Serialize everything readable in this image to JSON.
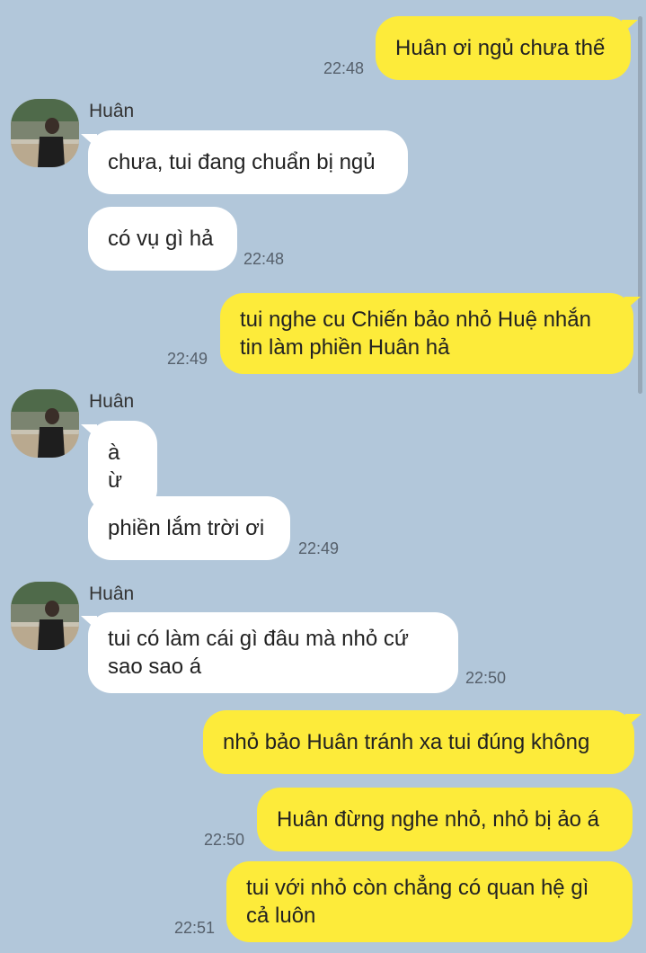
{
  "chat": {
    "contact_name": "Huân",
    "messages": [
      {
        "side": "out",
        "text": "Huân ơi ngủ chưa thế",
        "time": "22:48"
      },
      {
        "side": "in",
        "text": "chưa, tui đang chuẩn bị ngủ",
        "time": ""
      },
      {
        "side": "in",
        "text": "có vụ gì hả",
        "time": "22:48"
      },
      {
        "side": "out",
        "text": "tui nghe cu Chiến bảo nhỏ Huệ nhắn tin làm phiền Huân hả",
        "time": "22:49"
      },
      {
        "side": "in",
        "text": "à ừ",
        "time": ""
      },
      {
        "side": "in",
        "text": "phiền lắm trời ơi",
        "time": "22:49"
      },
      {
        "side": "in",
        "text": "tui có làm cái gì đâu mà nhỏ cứ sao sao á",
        "time": "22:50"
      },
      {
        "side": "out",
        "text": "nhỏ bảo Huân tránh xa tui đúng không",
        "time": ""
      },
      {
        "side": "out",
        "text": "Huân đừng nghe nhỏ, nhỏ bị ảo á",
        "time": "22:50"
      },
      {
        "side": "out",
        "text": "tui với nhỏ còn chẳng có quan hệ gì cả luôn",
        "time": "22:51"
      }
    ]
  },
  "colors": {
    "background": "#b2c7da",
    "outgoing_bubble": "#fdeb3a",
    "incoming_bubble": "#ffffff"
  },
  "icons": {
    "avatar": "avatar-photo"
  }
}
